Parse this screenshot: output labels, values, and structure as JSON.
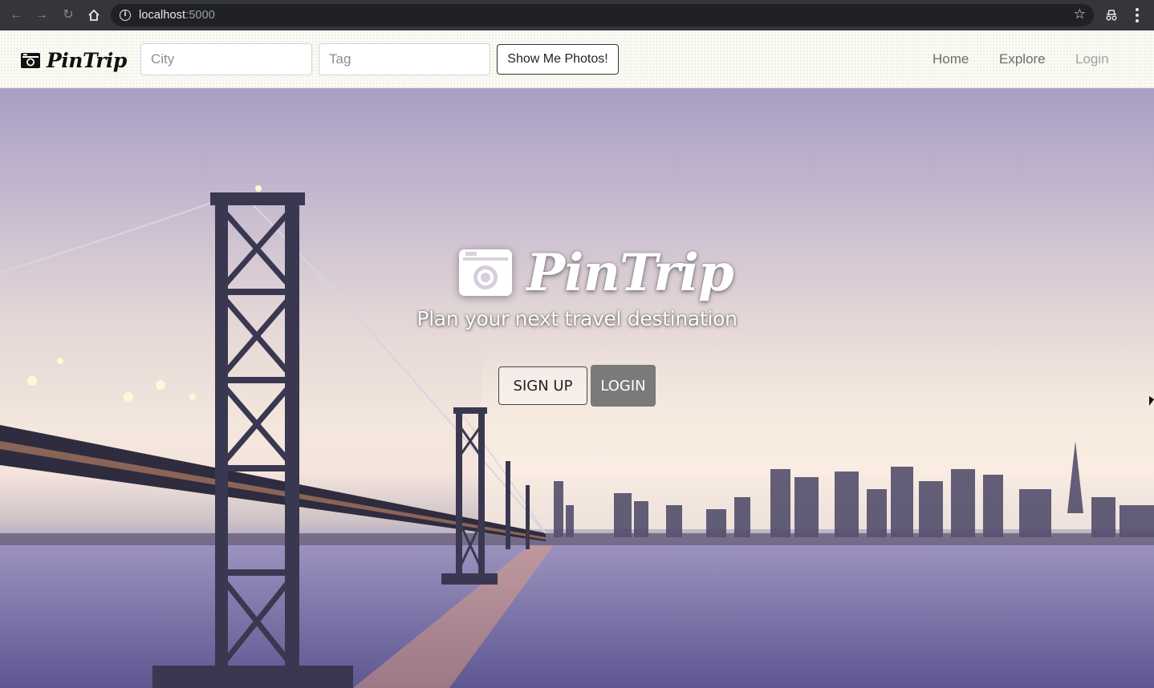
{
  "browser": {
    "url_host": "localhost",
    "url_port": ":5000",
    "back_icon": "arrow-left-icon",
    "forward_icon": "arrow-right-icon",
    "reload_icon": "reload-icon",
    "home_icon": "home-icon",
    "info_icon": "info-icon",
    "bookmark_icon": "star-icon",
    "extension_icon": "incognito-icon",
    "menu_icon": "kebab-menu-icon"
  },
  "navbar": {
    "brand": "PinTrip",
    "city_placeholder": "City",
    "tag_placeholder": "Tag",
    "search_button": "Show Me Photos!",
    "links": [
      {
        "label": "Home"
      },
      {
        "label": "Explore"
      },
      {
        "label": "Login"
      }
    ]
  },
  "hero": {
    "title": "PinTrip",
    "subtitle": "Plan your next travel destination",
    "signup_label": "SIGN UP",
    "login_label": "LOGIN"
  },
  "colors": {
    "chrome_bg": "#35363a",
    "navbar_bg": "#fbfbf5",
    "login_btn_bg": "#7a7a7a"
  }
}
